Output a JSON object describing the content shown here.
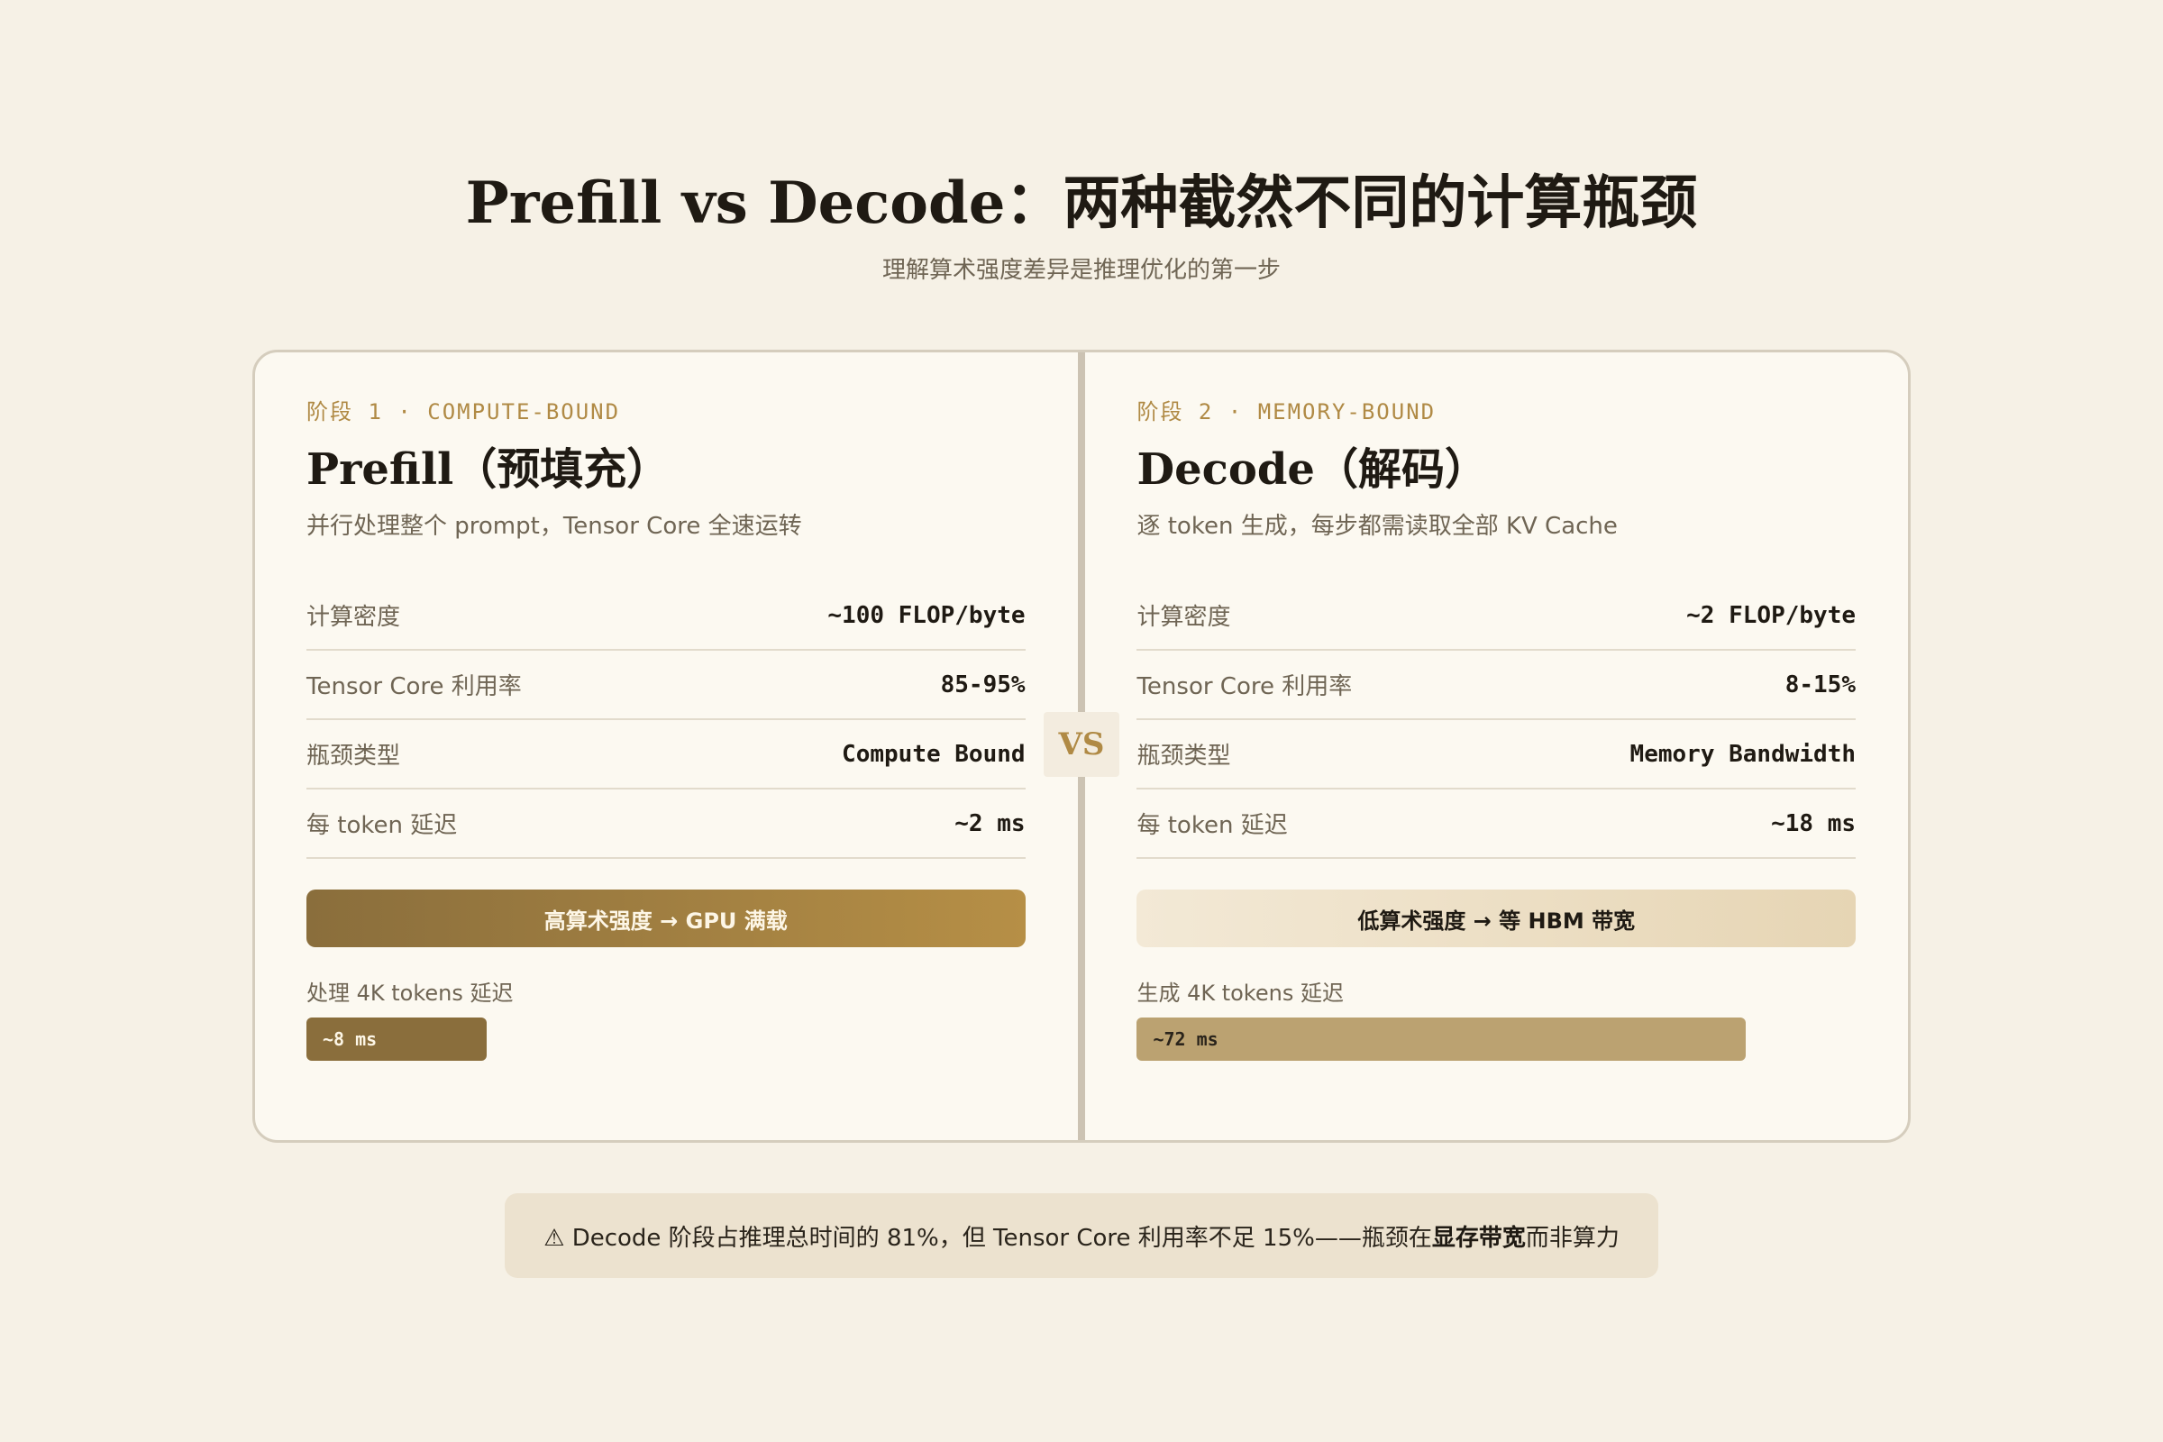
{
  "header": {
    "title": "Prefill vs Decode：两种截然不同的计算瓶颈",
    "subtitle": "理解算术强度差异是推理优化的第一步"
  },
  "vs_label": "VS",
  "panels": [
    {
      "stage": "阶段 1 · COMPUTE-BOUND",
      "title": "Prefill（预填充）",
      "description": "并行处理整个 prompt，Tensor Core 全速运转",
      "metrics": [
        {
          "label": "计算密度",
          "value": "~100 FLOP/byte"
        },
        {
          "label": "Tensor Core 利用率",
          "value": "85-95%"
        },
        {
          "label": "瓶颈类型",
          "value": "Compute Bound"
        },
        {
          "label": "每 token 延迟",
          "value": "~2 ms"
        }
      ],
      "verdict": "高算术强度 → GPU 满载",
      "latency_label": "处理 4K tokens 延迟",
      "latency_value": "~8 ms",
      "latency_ms": 8
    },
    {
      "stage": "阶段 2 · MEMORY-BOUND",
      "title": "Decode（解码）",
      "description": "逐 token 生成，每步都需读取全部 KV Cache",
      "metrics": [
        {
          "label": "计算密度",
          "value": "~2 FLOP/byte"
        },
        {
          "label": "Tensor Core 利用率",
          "value": "8-15%"
        },
        {
          "label": "瓶颈类型",
          "value": "Memory Bandwidth"
        },
        {
          "label": "每 token 延迟",
          "value": "~18 ms"
        }
      ],
      "verdict": "低算术强度 → 等 HBM 带宽",
      "latency_label": "生成 4K tokens 延迟",
      "latency_value": "~72 ms",
      "latency_ms": 72
    }
  ],
  "latency_scale_max_ms": 85,
  "insight": {
    "icon": "warning-icon",
    "prefix": "⚠ Decode 阶段占推理总时间的 81%，但 Tensor Core 利用率不足 15%——瓶颈在 ",
    "highlight": "显存带宽",
    "suffix": " 而非算力"
  },
  "colors": {
    "background": "#f6f1e6",
    "card": "#fcf9f1",
    "accent": "#b08a45",
    "accent_dark": "#8a6e3c",
    "accent_mid": "#bba271",
    "insight_bg": "#ece2cf"
  }
}
